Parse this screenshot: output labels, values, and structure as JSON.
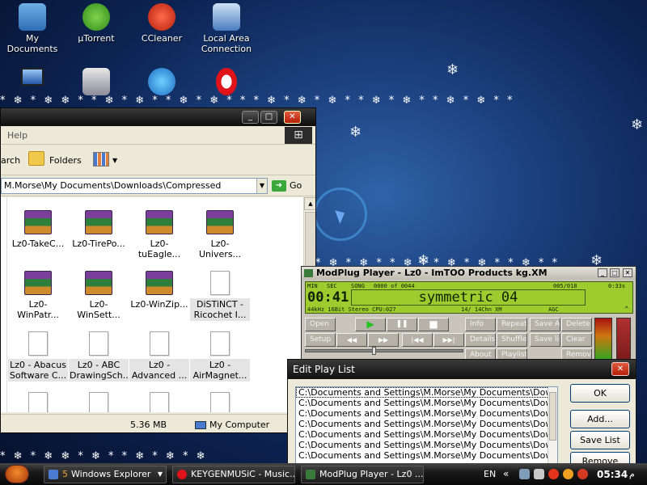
{
  "desktop": {
    "icons": [
      {
        "label": "My Documents"
      },
      {
        "label": "µTorrent"
      },
      {
        "label": "CCleaner"
      },
      {
        "label": "Local Area\nConnection"
      },
      {
        "label": "My Computer"
      },
      {
        "label": "Ultra"
      },
      {
        "label": "Internet"
      },
      {
        "label": "Opera"
      }
    ]
  },
  "explorer": {
    "menu_help": "Help",
    "toolbar": {
      "search": "arch",
      "folders": "Folders"
    },
    "address": "M.Morse\\My Documents\\Downloads\\Compressed",
    "go": "Go",
    "files": [
      {
        "name": "Lz0-TakeC...",
        "type": "rar"
      },
      {
        "name": "Lz0-TirePo...",
        "type": "rar"
      },
      {
        "name": "Lz0-tuEagle...",
        "type": "rar"
      },
      {
        "name": "Lz0-Univers...",
        "type": "rar"
      },
      {
        "name": "Lz0-WinPatr...",
        "type": "rar"
      },
      {
        "name": "Lz0-WinSett...",
        "type": "rar"
      },
      {
        "name": "Lz0-WinZip...",
        "type": "rar"
      },
      {
        "name": "DiSTiNCT -\nRicochet I...",
        "type": "doc"
      },
      {
        "name": "Lz0 - Abacus\nSoftware C...",
        "type": "doc"
      },
      {
        "name": "Lz0 - ABC\nDrawingSch...",
        "type": "doc"
      },
      {
        "name": "Lz0 -\nAdvanced ...",
        "type": "doc"
      },
      {
        "name": "Lz0 -\nAirMagnet...",
        "type": "doc"
      }
    ],
    "status": {
      "size": "5.36 MB",
      "location": "My Computer"
    }
  },
  "modplug": {
    "title": "ModPlug Player - Lz0 - ImTOO Products kg.XM",
    "lcd": {
      "min_label": "MIN",
      "sec_label": "SEC",
      "time": "00:41",
      "song_label": "SONG",
      "song_counter": "0000 of 0044",
      "position": "005/018",
      "length": "0:33s",
      "song_title": "symmetric 04",
      "info_line": "44kHz 16Bit Stereo CPU:027",
      "channels": "14/ 14Chn XM",
      "agc": "AGC"
    },
    "buttons": {
      "open": "Open",
      "setup": "Setup",
      "about": "About",
      "info": "Info",
      "details": "Details",
      "repeat": "Repeat",
      "shuffle": "Shuffle",
      "playlist": "Playlist",
      "save_as": "Save As",
      "save_list": "Save list",
      "delete": "Delete",
      "clear": "Clear",
      "remove": "Remove",
      "play": "▶",
      "pause": "❚❚",
      "stop": "■",
      "rewind": "◀◀",
      "forward": "▶▶",
      "prev": "|◀◀",
      "next": "▶▶|"
    },
    "seek_fraction": 0.43
  },
  "playlist_dialog": {
    "title": "Edit Play List",
    "entries": [
      "C:\\Documents and Settings\\M.Morse\\My Documents\\Downloads\\",
      "C:\\Documents and Settings\\M.Morse\\My Documents\\Downloads\\",
      "C:\\Documents and Settings\\M.Morse\\My Documents\\Downloads\\",
      "C:\\Documents and Settings\\M.Morse\\My Documents\\Downloads\\",
      "C:\\Documents and Settings\\M.Morse\\My Documents\\Downloads\\",
      "C:\\Documents and Settings\\M.Morse\\My Documents\\Downloads\\",
      "C:\\Documents and Settings\\M.Morse\\My Documents\\Downloads\\"
    ],
    "buttons": {
      "ok": "OK",
      "add": "Add...",
      "save_list": "Save List",
      "remove": "Remove"
    }
  },
  "taskbar": {
    "tasks": [
      {
        "count": "5",
        "label": "Windows Explorer"
      },
      {
        "label": "KEYGENMUSiC - Music..."
      },
      {
        "label": "ModPlug Player - Lz0 ..."
      }
    ],
    "tray": {
      "lang": "EN",
      "time": "05:34",
      "ampm": "م"
    }
  },
  "colors": {
    "lcd": "#9ecc2e",
    "desktop": "#0c2352",
    "start": "#f28c2a"
  }
}
